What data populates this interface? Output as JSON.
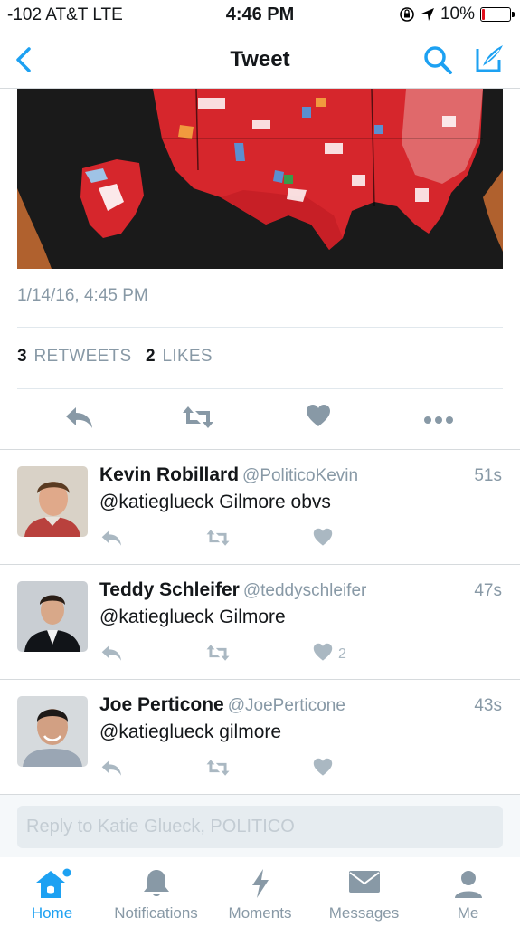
{
  "status_bar": {
    "carrier": "-102 AT&T  LTE",
    "time": "4:46 PM",
    "battery": "10%",
    "battery_level": 0.1,
    "battery_color": "#e0101d"
  },
  "nav": {
    "title": "Tweet",
    "back_icon": "chevron-left-icon",
    "search_icon": "search-icon",
    "compose_icon": "compose-tweet-icon",
    "accent": "#1da1f2"
  },
  "tweet": {
    "timestamp": "1/14/16, 4:45 PM",
    "retweets_count": "3",
    "retweets_label": "RETWEETS",
    "likes_count": "2",
    "likes_label": "LIKES",
    "actions": [
      "reply-icon",
      "retweet-icon",
      "like-icon",
      "more-icon"
    ]
  },
  "replies": [
    {
      "name": "Kevin Robillard",
      "handle": "@PoliticoKevin",
      "time": "51s",
      "text": "@katieglueck Gilmore obvs",
      "likes": ""
    },
    {
      "name": "Teddy Schleifer",
      "handle": "@teddyschleifer",
      "time": "47s",
      "text": "@katieglueck Gilmore",
      "likes": "2"
    },
    {
      "name": "Joe Perticone",
      "handle": "@JoePerticone",
      "time": "43s",
      "text": "@katieglueck gilmore",
      "likes": ""
    }
  ],
  "reply_box": {
    "placeholder": "Reply to Katie Glueck, POLITICO"
  },
  "tab_bar": {
    "tabs": [
      {
        "label": "Home",
        "icon": "home-icon",
        "active": true
      },
      {
        "label": "Notifications",
        "icon": "bell-icon",
        "active": false
      },
      {
        "label": "Moments",
        "icon": "lightning-icon",
        "active": false
      },
      {
        "label": "Messages",
        "icon": "envelope-icon",
        "active": false
      },
      {
        "label": "Me",
        "icon": "person-icon",
        "active": false
      }
    ]
  }
}
